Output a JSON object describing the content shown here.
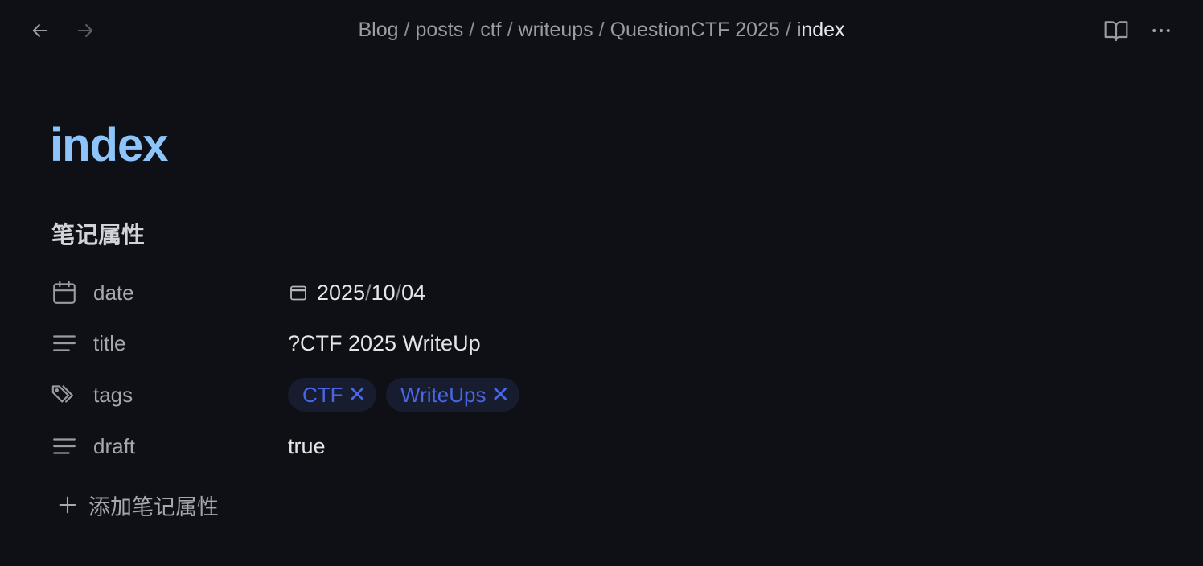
{
  "breadcrumb": {
    "items": [
      "Blog",
      "posts",
      "ctf",
      "writeups",
      "QuestionCTF 2025"
    ],
    "current": "index",
    "separator": "/"
  },
  "note": {
    "title": "index"
  },
  "properties": {
    "heading": "笔记属性",
    "date": {
      "key": "date",
      "year": "2025",
      "month": "10",
      "day": "04",
      "slash": "/"
    },
    "title": {
      "key": "title",
      "value": "?CTF 2025 WriteUp"
    },
    "tags": {
      "key": "tags",
      "values": [
        "CTF",
        "WriteUps"
      ],
      "remove_glyph": "✕"
    },
    "draft": {
      "key": "draft",
      "value": "true"
    },
    "add_label": "添加笔记属性"
  },
  "icons": {
    "back": "arrow-left-icon",
    "forward": "arrow-right-icon",
    "reading": "book-open-icon",
    "more": "more-horizontal-icon",
    "calendar": "calendar-icon",
    "text": "text-lines-icon",
    "tags": "tags-icon",
    "plus": "plus-icon"
  },
  "colors": {
    "background": "#0e1016",
    "title": "#8cc4fb",
    "tag_text": "#4a66e6",
    "tag_bg": "#171c2e"
  }
}
